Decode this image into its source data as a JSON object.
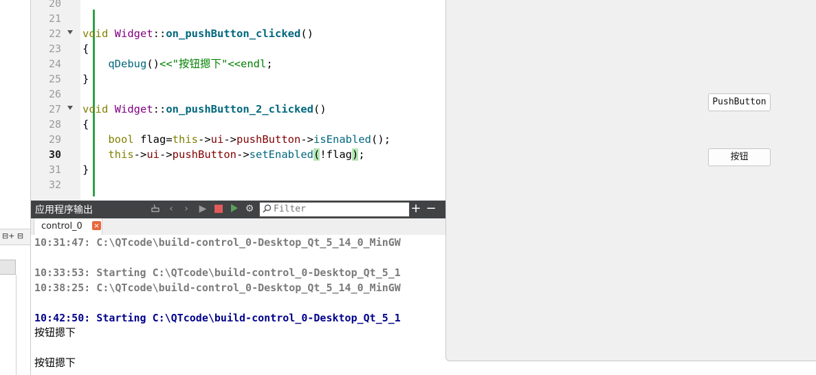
{
  "editor": {
    "lines": [
      {
        "num": "20"
      },
      {
        "num": "21"
      },
      {
        "num": "22",
        "fold": true
      },
      {
        "num": "23",
        "code": "{"
      },
      {
        "num": "24"
      },
      {
        "num": "25",
        "code": "}"
      },
      {
        "num": "26"
      },
      {
        "num": "27",
        "fold": true
      },
      {
        "num": "28",
        "code": "{"
      },
      {
        "num": "29"
      },
      {
        "num": "30",
        "current": true
      },
      {
        "num": "31",
        "code": "}"
      },
      {
        "num": "32"
      }
    ],
    "tokens": {
      "void": "void",
      "class_name": "Widget",
      "scope": "::",
      "func1": "on_pushButton_clicked",
      "func2": "on_pushButton_2_clicked",
      "parens": "()",
      "qdebug": "qDebug",
      "stream_op": "<<",
      "string_literal": "\"按钮摁下\"",
      "endl": "endl",
      "semicolon": ";",
      "bool": "bool",
      "flag": "flag",
      "eq": "=",
      "this": "this",
      "arrow": "->",
      "ui": "ui",
      "pushButton": "pushButton",
      "isEnabled": "isEnabled",
      "setEnabled": "setEnabled",
      "lparen": "(",
      "rparen": ")",
      "not_flag": "!flag"
    }
  },
  "output_pane": {
    "title": "应用程序输出",
    "filter_placeholder": "Filter",
    "tab_label": "control_0",
    "tab_close": "×",
    "buttons": {
      "prev": "‹",
      "next": "›",
      "run": "▶",
      "settings": "⚙",
      "add": "+",
      "remove": "−"
    },
    "lines": [
      {
        "text": "10:31:47: C:\\QTcode\\build-control_0-Desktop_Qt_5_14_0_MinGW",
        "style": "grey"
      },
      {
        "text": "",
        "style": "plain"
      },
      {
        "text": "10:33:53: Starting C:\\QTcode\\build-control_0-Desktop_Qt_5_1",
        "style": "grey"
      },
      {
        "text": "10:38:25: C:\\QTcode\\build-control_0-Desktop_Qt_5_14_0_MinGW",
        "style": "grey"
      },
      {
        "text": "",
        "style": "plain"
      },
      {
        "text": "10:42:50: Starting C:\\QTcode\\build-control_0-Desktop_Qt_5_1",
        "style": "blue"
      },
      {
        "text": "按钮摁下",
        "style": "plain"
      },
      {
        "text": "",
        "style": "plain"
      },
      {
        "text": "按钮摁下",
        "style": "plain"
      }
    ]
  },
  "left_panel": {
    "toolbar_icons": "⊟+ ⊟"
  },
  "widget_window": {
    "button1_label": "PushButton",
    "button2_label": "按钮"
  },
  "colors": {
    "keyword": "#808000",
    "type": "#800080",
    "function": "#00677c",
    "member": "#800000",
    "string": "#008000",
    "output_blue": "#00008b",
    "output_grey": "#7a7a7a",
    "changebar": "#2ea043",
    "stop_button": "#e25b5b"
  }
}
